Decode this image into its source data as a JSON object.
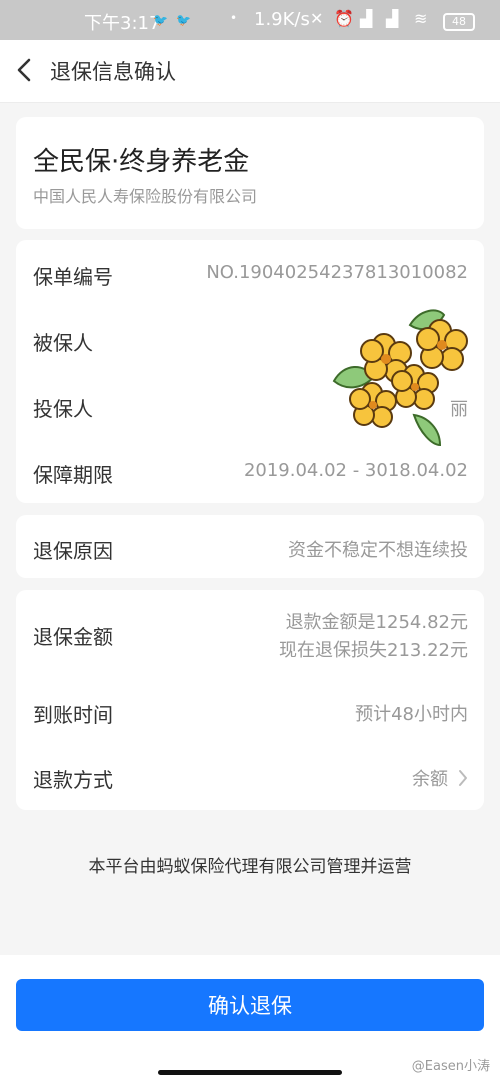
{
  "status_bar": {
    "time": "下午3:17",
    "net_speed": "1.9K/s",
    "battery": "48",
    "icons": [
      "bird-icon",
      "bird-icon",
      "dot-icon",
      "mute-icon",
      "alarm-icon",
      "signal-hd-icon",
      "signal-hd-icon",
      "wifi-icon",
      "battery-icon"
    ]
  },
  "nav": {
    "title": "退保信息确认",
    "back_icon": "chevron-left-icon"
  },
  "product": {
    "name": "全民保·终身养老金",
    "company": "中国人民人寿保险股份有限公司"
  },
  "policy": {
    "number_label": "保单编号",
    "number_value": "NO.19040254237813010082",
    "insured_label": "被保人",
    "holder_label": "投保人",
    "holder_partial": "丽",
    "period_label": "保障期限",
    "period_value": "2019.04.02 - 3018.04.02"
  },
  "reason": {
    "label": "退保原因",
    "value": "资金不稳定不想连续投"
  },
  "refund": {
    "amount_label": "退保金额",
    "amount_line1": "退款金额是1254.82元",
    "amount_line2": "现在退保损失213.22元",
    "arrival_label": "到账时间",
    "arrival_value": "预计48小时内",
    "method_label": "退款方式",
    "method_value": "余额",
    "method_icon": "chevron-right-icon"
  },
  "footer_note": "本平台由蚂蚁保险代理有限公司管理并运营",
  "confirm_button": "确认退保",
  "watermark": "@Easen小涛",
  "colors": {
    "primary": "#1677ff",
    "page_bg": "#f5f5f5",
    "muted_text": "#999999",
    "sticker_flower": "#f7c43d"
  }
}
